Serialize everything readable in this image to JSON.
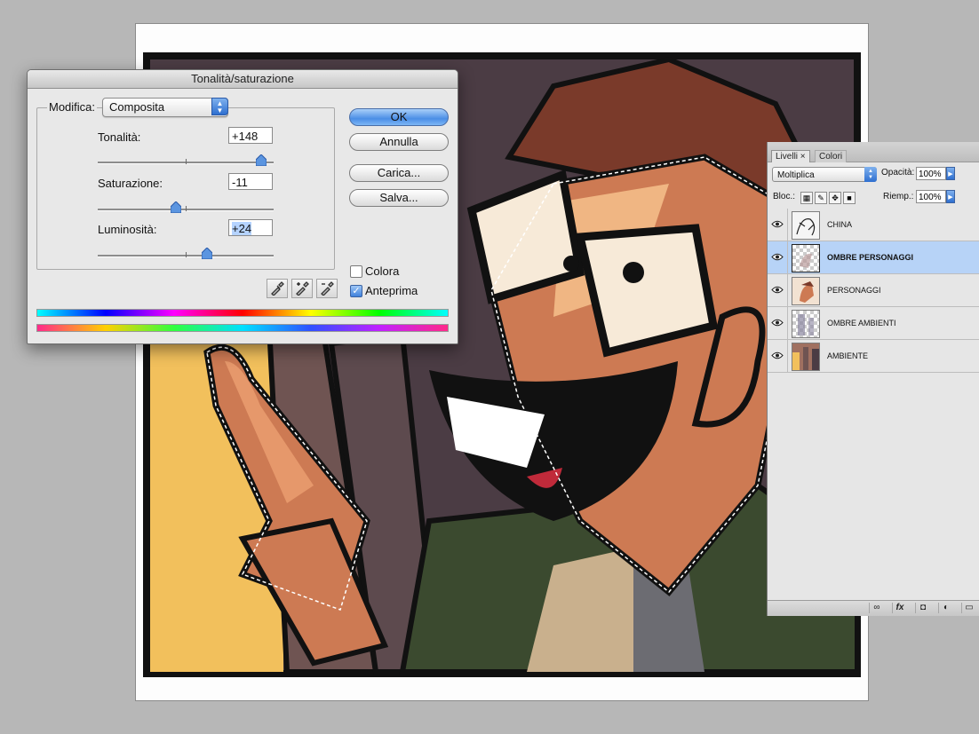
{
  "dialog": {
    "title": "Tonalità/saturazione",
    "modifica_label": "Modifica:",
    "modifica_value": "Composita",
    "hue_label": "Tonalità:",
    "hue_value": "+148",
    "saturation_label": "Saturazione:",
    "saturation_value": "-11",
    "lightness_label": "Luminosità:",
    "lightness_value": "+24",
    "ok_label": "OK",
    "cancel_label": "Annulla",
    "load_label": "Carica...",
    "save_label": "Salva...",
    "colorize_label": "Colora",
    "colorize_checked": false,
    "preview_label": "Anteprima",
    "preview_checked": true,
    "eyedroppers": [
      "eyedropper-icon",
      "eyedropper-plus-icon",
      "eyedropper-minus-icon"
    ]
  },
  "layers_panel": {
    "tab_active": "Livelli",
    "tab_other": "Colori",
    "blend_mode": "Moltiplica",
    "opacity_label": "Opacità:",
    "opacity_value": "100%",
    "lock_label": "Bloc.:",
    "fill_label": "Riemp.:",
    "fill_value": "100%",
    "layers": [
      {
        "name": "CHINA",
        "selected": false
      },
      {
        "name": "OMBRE PERSONAGGI",
        "selected": true
      },
      {
        "name": "PERSONAGGI",
        "selected": false
      },
      {
        "name": "OMBRE AMBIENTI",
        "selected": false
      },
      {
        "name": "AMBIENTE",
        "selected": false
      }
    ],
    "footer_icons": [
      "link-icon",
      "fx-icon",
      "mask-icon",
      "adjustment-icon",
      "folder-icon"
    ]
  },
  "colors": {
    "skin": "#cd7a53",
    "skin_light": "#f0b683",
    "hair": "#7a3a2a",
    "background": "#4b3c44",
    "yellow": "#f2c05c",
    "jacket": "#3b4a2f",
    "selected_layer": "#b7d3f7"
  }
}
